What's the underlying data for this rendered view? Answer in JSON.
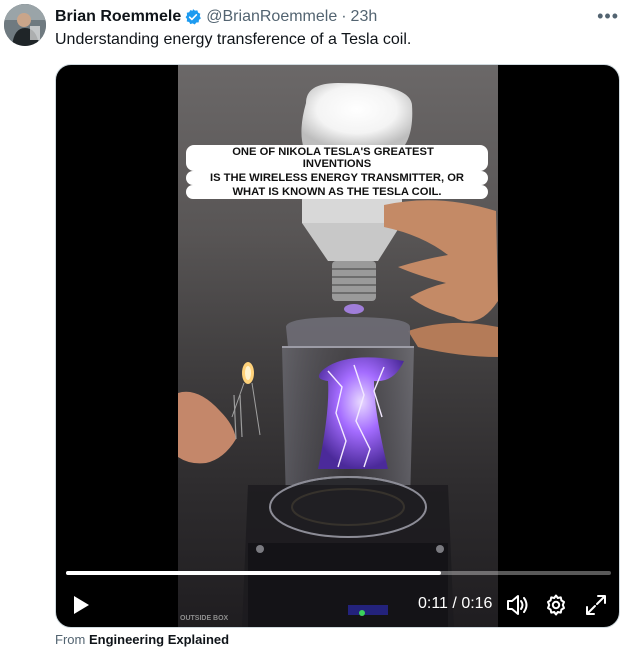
{
  "tweet": {
    "author_name": "Brian Roemmele",
    "handle": "@BrianRoemmele",
    "separator": "·",
    "time": "23h",
    "more_label": "•••",
    "text": "Understanding energy transference of a Tesla coil.",
    "verified_color": "#1d9bf0"
  },
  "video": {
    "caption_lines": [
      "ONE OF NIKOLA TESLA'S GREATEST INVENTIONS",
      "IS THE WIRELESS ENERGY TRANSMITTER, OR",
      "WHAT IS KNOWN AS THE TESLA COIL."
    ],
    "watermark": "OUTSIDE BOX",
    "elapsed": "0:11",
    "duration": "0:16",
    "time_separator": "/",
    "progress_fraction": 0.6875
  },
  "footer": {
    "from_prefix": "From",
    "from_source": "Engineering Explained"
  }
}
